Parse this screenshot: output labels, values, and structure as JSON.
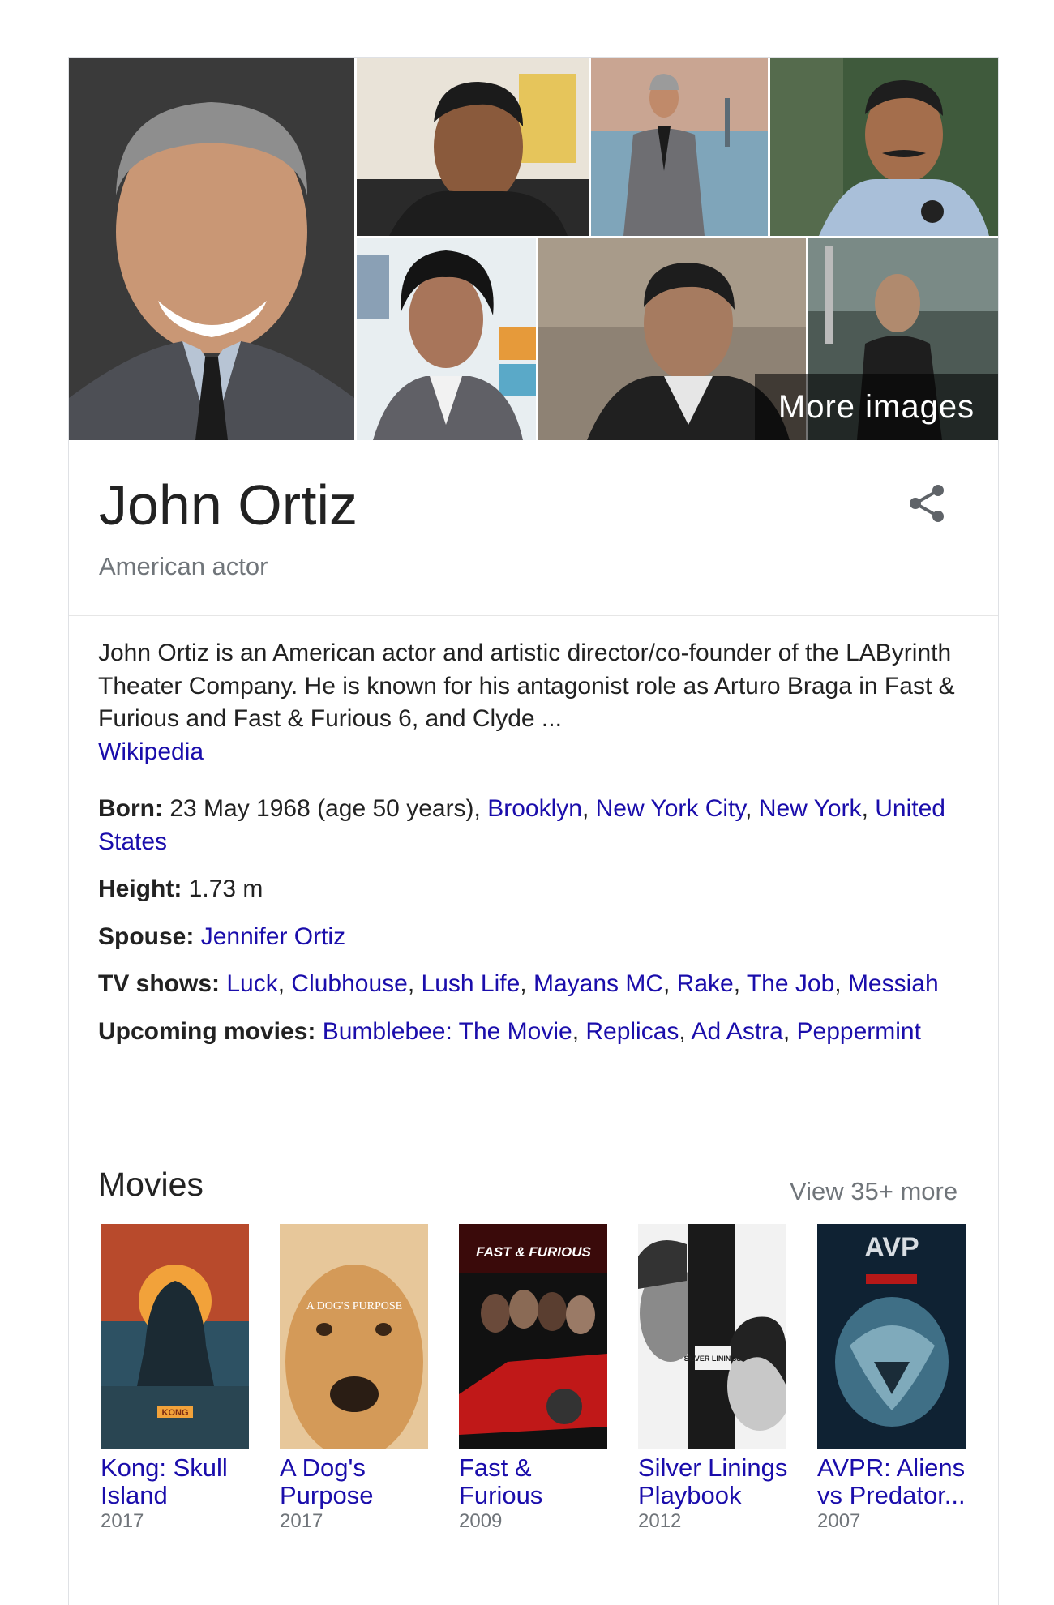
{
  "gallery": {
    "more_images": "More images"
  },
  "entity": {
    "name": "John Ortiz",
    "subtitle": "American actor"
  },
  "description": {
    "text": "John Ortiz is an American actor and artistic director/co-founder of the LAByrinth Theater Company. He is known for his antagonist role as Arturo Braga in Fast & Furious and Fast & Furious 6, and Clyde ...",
    "source": "Wikipedia"
  },
  "facts": {
    "born": {
      "label": "Born:",
      "value": "23 May 1968 (age 50 years),",
      "links": [
        "Brooklyn",
        "New York City",
        "New York",
        "United States"
      ]
    },
    "height": {
      "label": "Height:",
      "value": "1.73 m"
    },
    "spouse": {
      "label": "Spouse:",
      "link": "Jennifer Ortiz"
    },
    "tv_shows": {
      "label": "TV shows:",
      "links": [
        "Luck",
        "Clubhouse",
        "Lush Life",
        "Mayans MC",
        "Rake",
        "The Job",
        "Messiah"
      ]
    },
    "upcoming": {
      "label": "Upcoming movies:",
      "links": [
        "Bumblebee: The Movie",
        "Replicas",
        "Ad Astra",
        "Peppermint"
      ]
    }
  },
  "movies": {
    "heading": "Movies",
    "view_more": "View 35+ more",
    "items": [
      {
        "title": "Kong: Skull Island",
        "year": "2017"
      },
      {
        "title": "A Dog's Purpose",
        "year": "2017"
      },
      {
        "title": "Fast & Furious",
        "year": "2009"
      },
      {
        "title": "Silver Linings Playbook",
        "year": "2012"
      },
      {
        "title": "AVPR: Aliens vs Predator...",
        "year": "2007"
      }
    ]
  },
  "poster_text": {
    "dogs_purpose": "A DOG'S PURPOSE",
    "fast_furious": "FAST & FURIOUS",
    "silver_linings": "SILVER LININGS",
    "avp": "AVP",
    "kong": "KONG"
  },
  "icons": {
    "share": "share-icon"
  },
  "colors": {
    "link": "#1a0dab",
    "muted": "#70757a",
    "text": "#222222"
  }
}
